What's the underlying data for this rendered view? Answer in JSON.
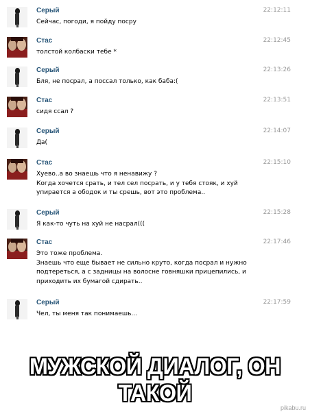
{
  "messages": [
    {
      "sender": "Серый",
      "avatar": "seryi",
      "time": "22:12:11",
      "lines": [
        "Сейчас, погоди, я пойду посру"
      ]
    },
    {
      "sender": "Стас",
      "avatar": "stas",
      "time": "22:12:45",
      "lines": [
        "толстой колбаски тебе *"
      ]
    },
    {
      "sender": "Серый",
      "avatar": "seryi",
      "time": "22:13:26",
      "lines": [
        "Бля, не посрал, а поссал только, как баба:("
      ]
    },
    {
      "sender": "Стас",
      "avatar": "stas",
      "time": "22:13:51",
      "lines": [
        "сидя ссал ?"
      ]
    },
    {
      "sender": "Серый",
      "avatar": "seryi",
      "time": "22:14:07",
      "lines": [
        "Да("
      ]
    },
    {
      "sender": "Стас",
      "avatar": "stas",
      "time": "22:15:10",
      "lines": [
        "Хуево..а во знаешь что я ненавижу ?",
        "Когда хочется срать, и тел сел посрать, и у тебя стояк, и хуй",
        "упирается а ободок и ты срешь, вот это проблема.."
      ]
    },
    {
      "sender": "Серый",
      "avatar": "seryi",
      "time": "22:15:28",
      "lines": [
        "Я как-то чуть на хуй не насрал((("
      ]
    },
    {
      "sender": "Стас",
      "avatar": "stas",
      "time": "22:17:46",
      "lines": [
        "Это тоже проблема.",
        "Знаешь что еще бывает не сильно круто, когда посрал и нужно",
        "подтереться, а с задницы на волосне говняшки прицепились, и",
        "приходить их бумагой сдирать.."
      ]
    },
    {
      "sender": "Серый",
      "avatar": "seryi",
      "time": "22:17:59",
      "lines": [
        "Чел, ты меня так понимаешь..."
      ]
    }
  ],
  "caption": "МУЖСКОЙ ДИАЛОГ, ОН ТАКОЙ",
  "watermark": "pikabu.ru"
}
